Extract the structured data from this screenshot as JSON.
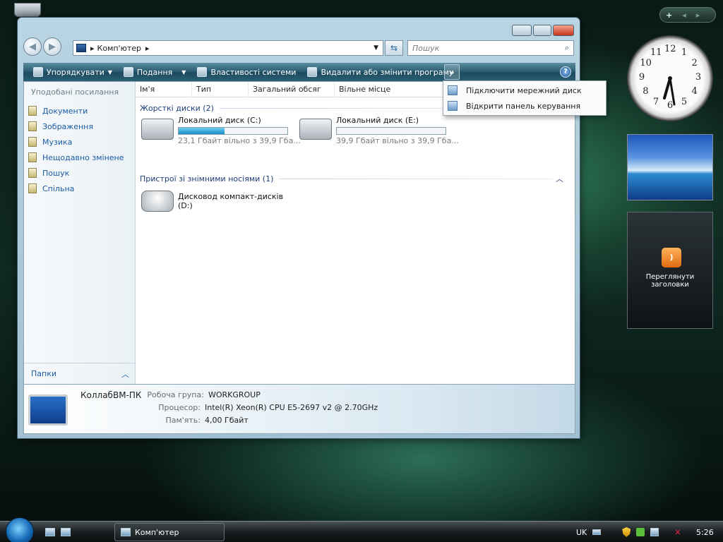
{
  "window": {
    "address": {
      "path": "Комп'ютер",
      "separator": "▸"
    },
    "search": {
      "placeholder": "Пошук"
    },
    "toolbar": {
      "organize": "Упорядкувати",
      "views": "Подання",
      "system_properties": "Властивості системи",
      "uninstall": "Видалити або змінити програму",
      "more": "»",
      "help": "?"
    },
    "overflow_menu": [
      {
        "label": "Підключити мережний диск"
      },
      {
        "label": "Відкрити панель керування"
      }
    ],
    "nav_pane": {
      "header": "Уподобані посилання",
      "items": [
        {
          "label": "Документи"
        },
        {
          "label": "Зображення"
        },
        {
          "label": "Музика"
        },
        {
          "label": "Нещодавно змінене"
        },
        {
          "label": "Пошук"
        },
        {
          "label": "Спільна"
        }
      ],
      "folders": "Папки"
    },
    "columns": [
      "Ім'я",
      "Тип",
      "Загальний обсяг",
      "Вільне місце"
    ],
    "groups": {
      "hard_drives": "Жорсткі диски (2)",
      "removable": "Пристрої зі знімними носіями (1)"
    },
    "drives": [
      {
        "name": "Локальний диск (C:)",
        "free": "23,1 Гбайт вільно з 39,9 Гба...",
        "used_fraction": 0.42
      },
      {
        "name": "Локальний диск (E:)",
        "free": "39,9 Гбайт вільно з 39,9 Гба...",
        "used_fraction": 0.0
      }
    ],
    "cd_drive": {
      "name_line1": "Дисковод компакт-дисків",
      "name_line2": "(D:)"
    },
    "details": {
      "computer_name": "КоллабВМ-ПК",
      "workgroup_label": "Робоча група:",
      "workgroup": "WORKGROUP",
      "cpu_label": "Процесор:",
      "cpu": "Intel(R) Xeon(R) CPU E5-2697 v2 @ 2.70GHz",
      "memory_label": "Пам'ять:",
      "memory": "4,00 Гбайт"
    }
  },
  "sidebar": {
    "add": "+",
    "clock_numbers": [
      "12",
      "1",
      "2",
      "3",
      "4",
      "5",
      "6",
      "7",
      "8",
      "9",
      "10",
      "11"
    ],
    "feed_label": "Переглянути заголовки"
  },
  "taskbar": {
    "task": "Комп'ютер",
    "lang": "UK",
    "time": "5:26"
  }
}
